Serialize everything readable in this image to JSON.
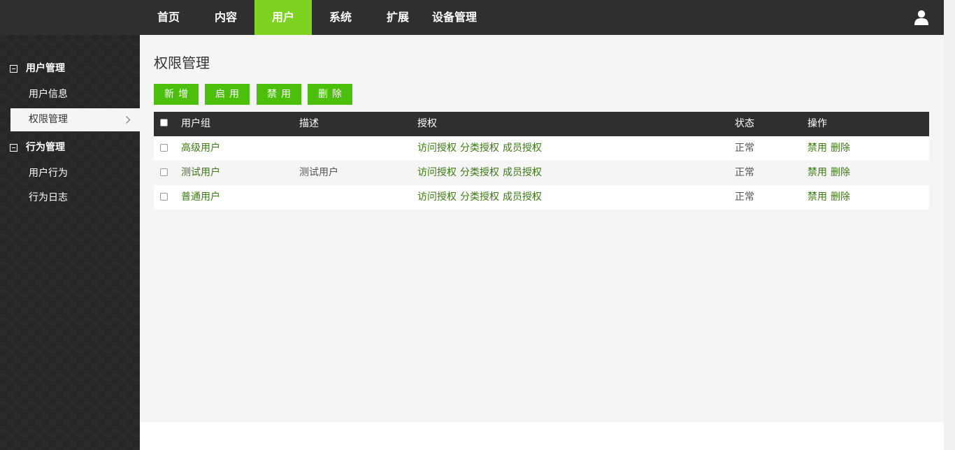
{
  "nav": {
    "items": [
      "首页",
      "内容",
      "用户",
      "系统",
      "扩展",
      "设备管理"
    ],
    "active_index": 2
  },
  "sidebar": {
    "groups": [
      {
        "title": "用户管理",
        "items": [
          "用户信息",
          "权限管理"
        ]
      },
      {
        "title": "行为管理",
        "items": [
          "用户行为",
          "行为日志"
        ]
      }
    ],
    "active_item": "权限管理"
  },
  "page": {
    "title": "权限管理"
  },
  "toolbar": {
    "buttons": [
      "新增",
      "启用",
      "禁用",
      "删除"
    ]
  },
  "table": {
    "headers": [
      "用户组",
      "描述",
      "授权",
      "状态",
      "操作"
    ],
    "rows": [
      {
        "name": "高级用户",
        "desc": "",
        "auth": [
          "访问授权",
          "分类授权",
          "成员授权"
        ],
        "status": "正常",
        "ops": [
          "禁用",
          "删除"
        ]
      },
      {
        "name": "测试用户",
        "desc": "测试用户",
        "auth": [
          "访问授权",
          "分类授权",
          "成员授权"
        ],
        "status": "正常",
        "ops": [
          "禁用",
          "删除"
        ]
      },
      {
        "name": "普通用户",
        "desc": "",
        "auth": [
          "访问授权",
          "分类授权",
          "成员授权"
        ],
        "status": "正常",
        "ops": [
          "禁用",
          "删除"
        ]
      }
    ]
  },
  "colors": {
    "topbar": "#2f2f2f",
    "nav_active": "#7ed321",
    "button": "#4bbf0c",
    "link": "#3a7a12",
    "content_bg": "#f5f5f5"
  },
  "icons": {
    "user": "user-icon",
    "collapse": "minus-square-icon",
    "chevron": "chevron-right-icon"
  }
}
